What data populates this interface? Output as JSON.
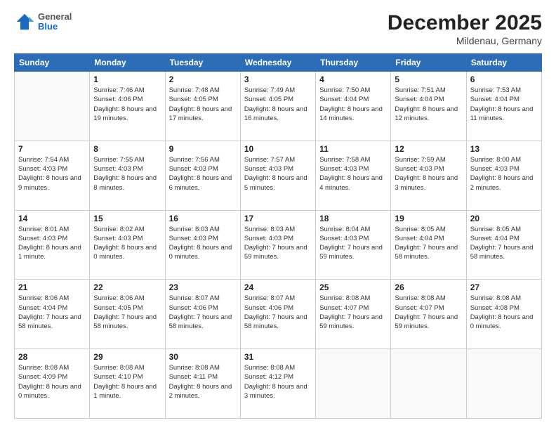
{
  "header": {
    "logo": {
      "general": "General",
      "blue": "Blue"
    },
    "title": "December 2025",
    "location": "Mildenau, Germany"
  },
  "days_of_week": [
    "Sunday",
    "Monday",
    "Tuesday",
    "Wednesday",
    "Thursday",
    "Friday",
    "Saturday"
  ],
  "weeks": [
    [
      {
        "day": "",
        "sunrise": "",
        "sunset": "",
        "daylight": ""
      },
      {
        "day": "1",
        "sunrise": "Sunrise: 7:46 AM",
        "sunset": "Sunset: 4:06 PM",
        "daylight": "Daylight: 8 hours and 19 minutes."
      },
      {
        "day": "2",
        "sunrise": "Sunrise: 7:48 AM",
        "sunset": "Sunset: 4:05 PM",
        "daylight": "Daylight: 8 hours and 17 minutes."
      },
      {
        "day": "3",
        "sunrise": "Sunrise: 7:49 AM",
        "sunset": "Sunset: 4:05 PM",
        "daylight": "Daylight: 8 hours and 16 minutes."
      },
      {
        "day": "4",
        "sunrise": "Sunrise: 7:50 AM",
        "sunset": "Sunset: 4:04 PM",
        "daylight": "Daylight: 8 hours and 14 minutes."
      },
      {
        "day": "5",
        "sunrise": "Sunrise: 7:51 AM",
        "sunset": "Sunset: 4:04 PM",
        "daylight": "Daylight: 8 hours and 12 minutes."
      },
      {
        "day": "6",
        "sunrise": "Sunrise: 7:53 AM",
        "sunset": "Sunset: 4:04 PM",
        "daylight": "Daylight: 8 hours and 11 minutes."
      }
    ],
    [
      {
        "day": "7",
        "sunrise": "Sunrise: 7:54 AM",
        "sunset": "Sunset: 4:03 PM",
        "daylight": "Daylight: 8 hours and 9 minutes."
      },
      {
        "day": "8",
        "sunrise": "Sunrise: 7:55 AM",
        "sunset": "Sunset: 4:03 PM",
        "daylight": "Daylight: 8 hours and 8 minutes."
      },
      {
        "day": "9",
        "sunrise": "Sunrise: 7:56 AM",
        "sunset": "Sunset: 4:03 PM",
        "daylight": "Daylight: 8 hours and 6 minutes."
      },
      {
        "day": "10",
        "sunrise": "Sunrise: 7:57 AM",
        "sunset": "Sunset: 4:03 PM",
        "daylight": "Daylight: 8 hours and 5 minutes."
      },
      {
        "day": "11",
        "sunrise": "Sunrise: 7:58 AM",
        "sunset": "Sunset: 4:03 PM",
        "daylight": "Daylight: 8 hours and 4 minutes."
      },
      {
        "day": "12",
        "sunrise": "Sunrise: 7:59 AM",
        "sunset": "Sunset: 4:03 PM",
        "daylight": "Daylight: 8 hours and 3 minutes."
      },
      {
        "day": "13",
        "sunrise": "Sunrise: 8:00 AM",
        "sunset": "Sunset: 4:03 PM",
        "daylight": "Daylight: 8 hours and 2 minutes."
      }
    ],
    [
      {
        "day": "14",
        "sunrise": "Sunrise: 8:01 AM",
        "sunset": "Sunset: 4:03 PM",
        "daylight": "Daylight: 8 hours and 1 minute."
      },
      {
        "day": "15",
        "sunrise": "Sunrise: 8:02 AM",
        "sunset": "Sunset: 4:03 PM",
        "daylight": "Daylight: 8 hours and 0 minutes."
      },
      {
        "day": "16",
        "sunrise": "Sunrise: 8:03 AM",
        "sunset": "Sunset: 4:03 PM",
        "daylight": "Daylight: 8 hours and 0 minutes."
      },
      {
        "day": "17",
        "sunrise": "Sunrise: 8:03 AM",
        "sunset": "Sunset: 4:03 PM",
        "daylight": "Daylight: 7 hours and 59 minutes."
      },
      {
        "day": "18",
        "sunrise": "Sunrise: 8:04 AM",
        "sunset": "Sunset: 4:03 PM",
        "daylight": "Daylight: 7 hours and 59 minutes."
      },
      {
        "day": "19",
        "sunrise": "Sunrise: 8:05 AM",
        "sunset": "Sunset: 4:04 PM",
        "daylight": "Daylight: 7 hours and 58 minutes."
      },
      {
        "day": "20",
        "sunrise": "Sunrise: 8:05 AM",
        "sunset": "Sunset: 4:04 PM",
        "daylight": "Daylight: 7 hours and 58 minutes."
      }
    ],
    [
      {
        "day": "21",
        "sunrise": "Sunrise: 8:06 AM",
        "sunset": "Sunset: 4:04 PM",
        "daylight": "Daylight: 7 hours and 58 minutes."
      },
      {
        "day": "22",
        "sunrise": "Sunrise: 8:06 AM",
        "sunset": "Sunset: 4:05 PM",
        "daylight": "Daylight: 7 hours and 58 minutes."
      },
      {
        "day": "23",
        "sunrise": "Sunrise: 8:07 AM",
        "sunset": "Sunset: 4:06 PM",
        "daylight": "Daylight: 7 hours and 58 minutes."
      },
      {
        "day": "24",
        "sunrise": "Sunrise: 8:07 AM",
        "sunset": "Sunset: 4:06 PM",
        "daylight": "Daylight: 7 hours and 58 minutes."
      },
      {
        "day": "25",
        "sunrise": "Sunrise: 8:08 AM",
        "sunset": "Sunset: 4:07 PM",
        "daylight": "Daylight: 7 hours and 59 minutes."
      },
      {
        "day": "26",
        "sunrise": "Sunrise: 8:08 AM",
        "sunset": "Sunset: 4:07 PM",
        "daylight": "Daylight: 7 hours and 59 minutes."
      },
      {
        "day": "27",
        "sunrise": "Sunrise: 8:08 AM",
        "sunset": "Sunset: 4:08 PM",
        "daylight": "Daylight: 8 hours and 0 minutes."
      }
    ],
    [
      {
        "day": "28",
        "sunrise": "Sunrise: 8:08 AM",
        "sunset": "Sunset: 4:09 PM",
        "daylight": "Daylight: 8 hours and 0 minutes."
      },
      {
        "day": "29",
        "sunrise": "Sunrise: 8:08 AM",
        "sunset": "Sunset: 4:10 PM",
        "daylight": "Daylight: 8 hours and 1 minute."
      },
      {
        "day": "30",
        "sunrise": "Sunrise: 8:08 AM",
        "sunset": "Sunset: 4:11 PM",
        "daylight": "Daylight: 8 hours and 2 minutes."
      },
      {
        "day": "31",
        "sunrise": "Sunrise: 8:08 AM",
        "sunset": "Sunset: 4:12 PM",
        "daylight": "Daylight: 8 hours and 3 minutes."
      },
      {
        "day": "",
        "sunrise": "",
        "sunset": "",
        "daylight": ""
      },
      {
        "day": "",
        "sunrise": "",
        "sunset": "",
        "daylight": ""
      },
      {
        "day": "",
        "sunrise": "",
        "sunset": "",
        "daylight": ""
      }
    ]
  ]
}
